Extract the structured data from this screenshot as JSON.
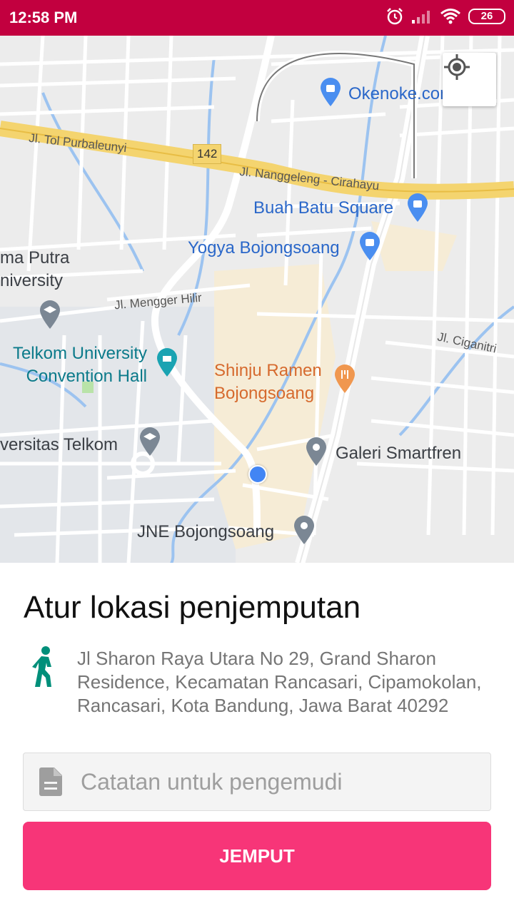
{
  "status_bar": {
    "time": "12:58 PM",
    "battery": "26",
    "background": "#c2003f",
    "icons": [
      "alarm-icon",
      "signal-icon",
      "wifi-icon",
      "battery-icon"
    ]
  },
  "map": {
    "places": [
      {
        "label": "Okenoke.com",
        "kind": "shopping"
      },
      {
        "label": "Buah Batu Square",
        "kind": "shopping"
      },
      {
        "label": "Yogya Bojongsoang",
        "kind": "shopping"
      },
      {
        "label": "ma Putra\nniversity",
        "kind": "university"
      },
      {
        "label": "Telkom University\nConvention Hall",
        "kind": "venue"
      },
      {
        "label": "Shinju Ramen\nBojongsoang",
        "kind": "restaurant"
      },
      {
        "label": "versitas Telkom",
        "kind": "university"
      },
      {
        "label": "Galeri Smartfren",
        "kind": "place"
      },
      {
        "label": "JNE Bojongsoang",
        "kind": "place"
      }
    ],
    "roads": [
      "Jl. Tol Purbaleunyi",
      "Jl. Nanggeleng - Cirahayu",
      "Jl. Mengger Hilir",
      "Jl. Ciganitri"
    ],
    "route_shield": "142",
    "locate_button_icon": "my-location-icon"
  },
  "sheet": {
    "title": "Atur lokasi penjemputan",
    "address": "Jl Sharon Raya Utara No 29, Grand Sharon Residence, Kecamatan Rancasari, Cipamokolan, Rancasari, Kota Bandung, Jawa Barat 40292",
    "note_placeholder": "Catatan untuk pengemudi",
    "note_value": "",
    "pickup_button": "JEMPUT"
  },
  "colors": {
    "accent": "#f73578",
    "status_bar": "#c2003f",
    "walk_icon": "#008f7a"
  }
}
